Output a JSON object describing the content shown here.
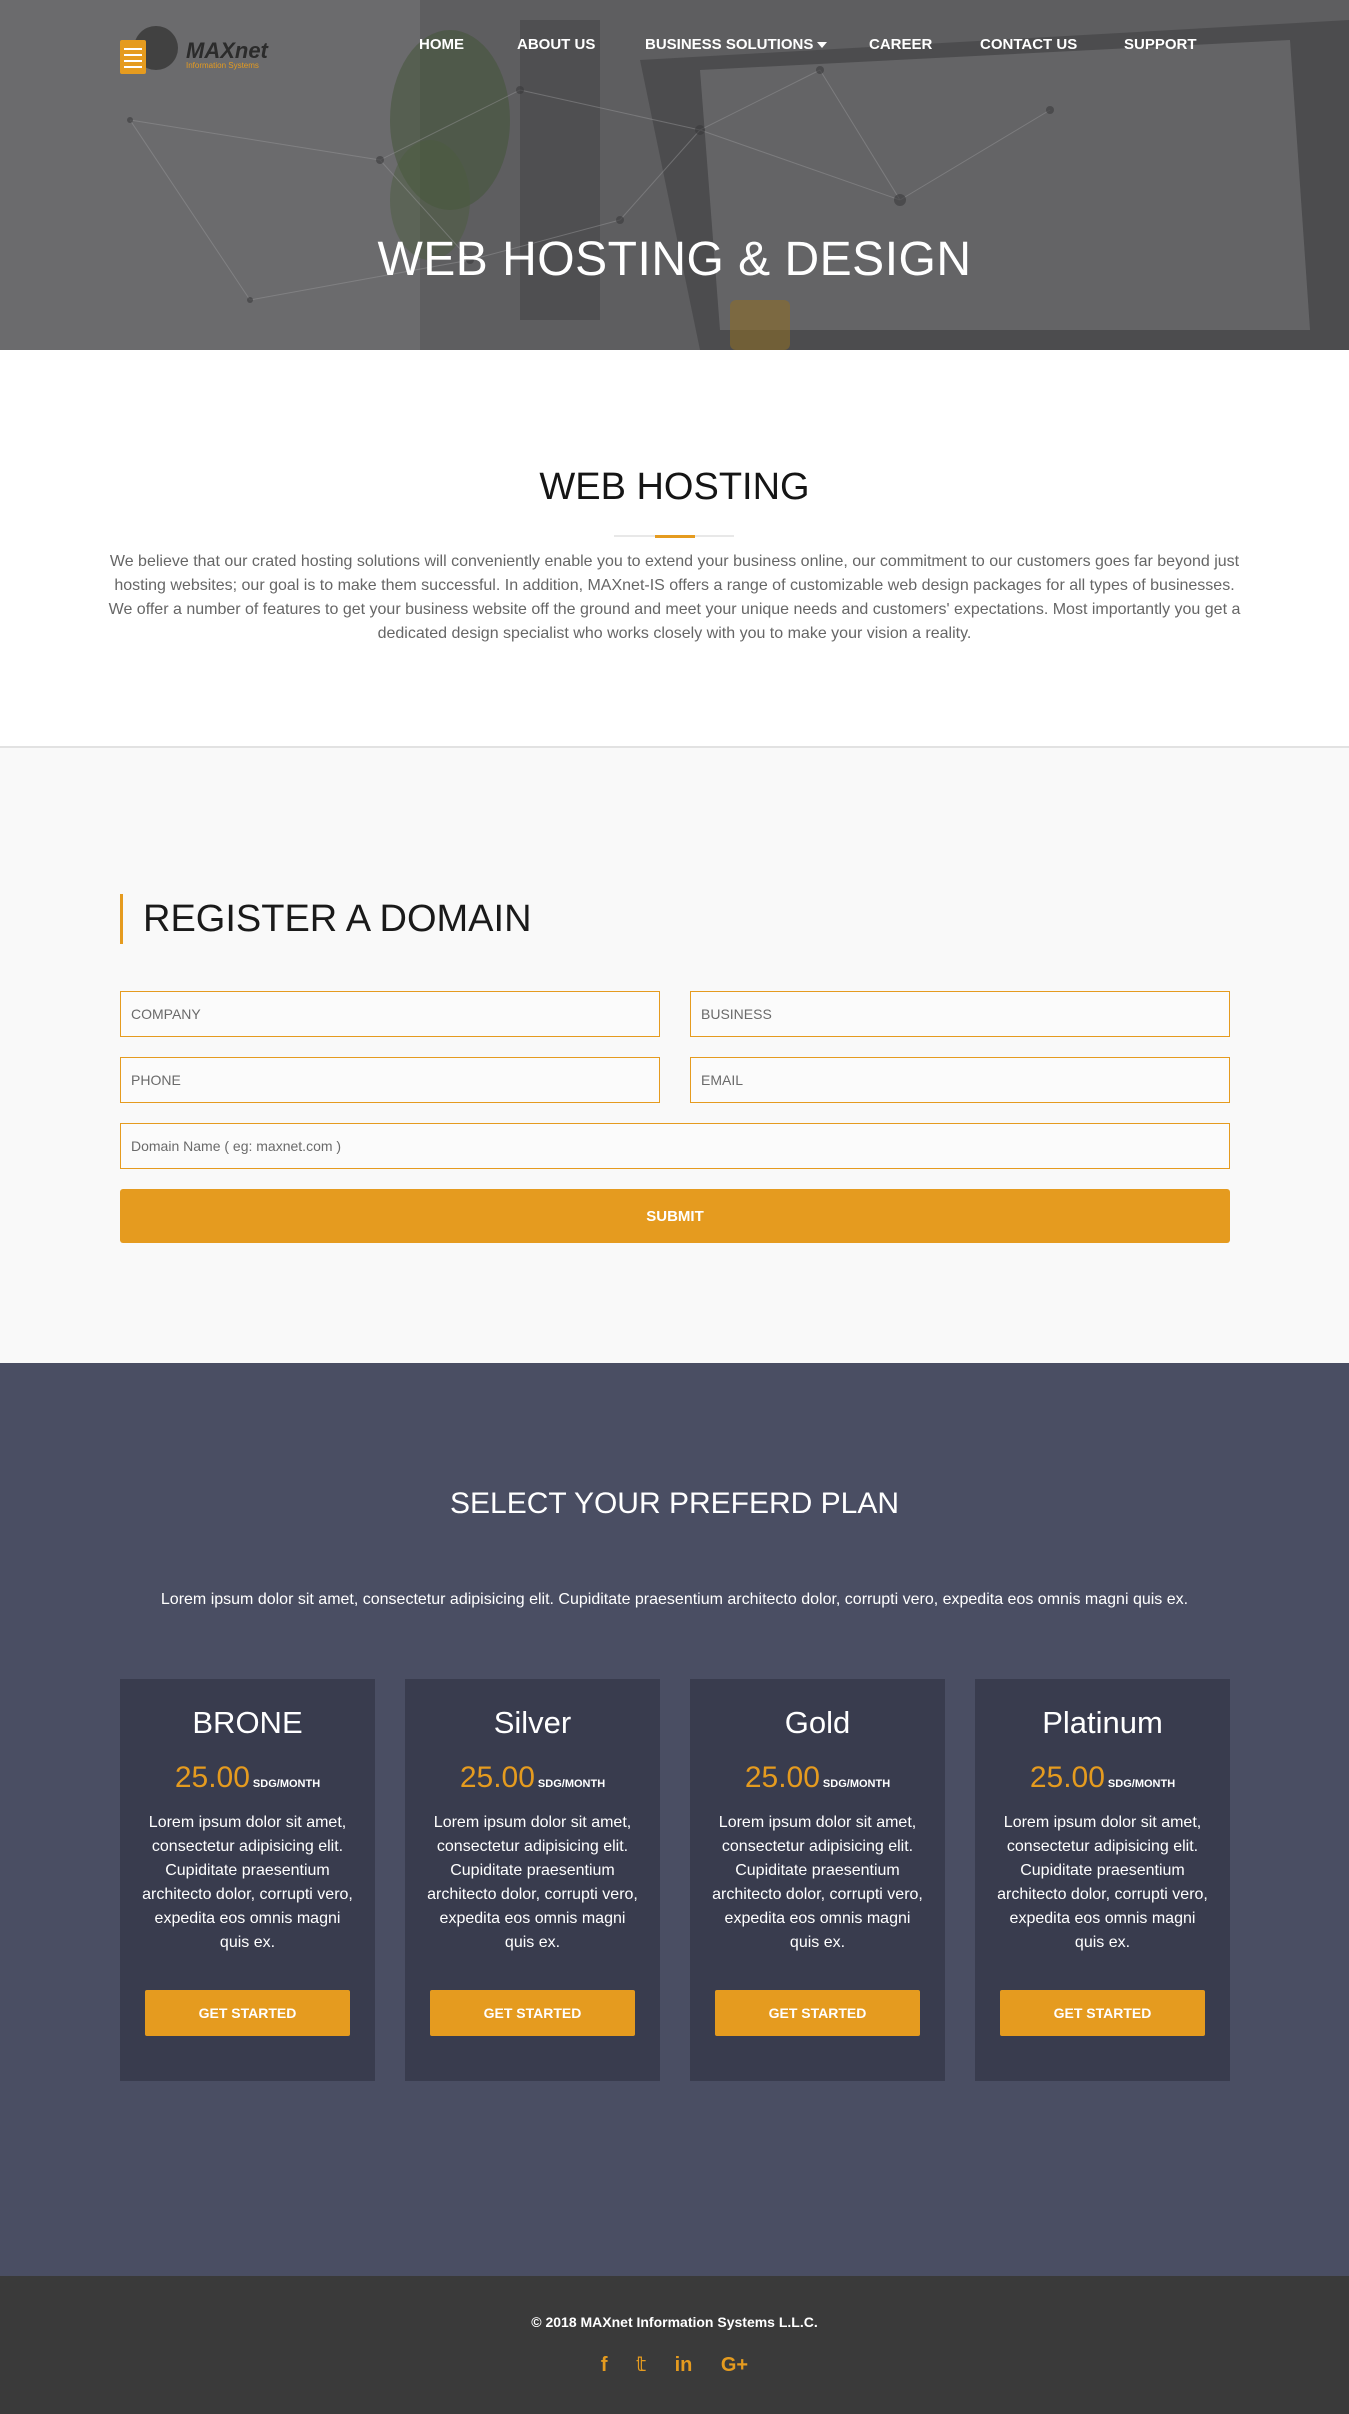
{
  "header": {
    "logo": {
      "name": "MAXnet",
      "subtitle": "Information Systems"
    },
    "nav": [
      {
        "label": "HOME"
      },
      {
        "label": "ABOUT US"
      },
      {
        "label": "BUSINESS SOLUTIONS",
        "has_dropdown": true
      },
      {
        "label": "CAREER"
      },
      {
        "label": "CONTACT US"
      },
      {
        "label": "SUPPORT"
      }
    ],
    "hero_title": "WEB HOSTING & DESIGN"
  },
  "about": {
    "title": "WEB HOSTING",
    "body": "We believe that our crated hosting solutions will conveniently enable you to extend your business online, our commitment to our customers goes far beyond just hosting websites; our goal is to make them successful. In addition, MAXnet-IS offers a range of customizable web design packages for all types of businesses. We offer a number of features to get your business website off the ground and meet your unique needs and customers' expectations. Most importantly you get a dedicated design specialist who works closely with you to make your vision a reality."
  },
  "register": {
    "title": "REGISTER A DOMAIN",
    "fields": {
      "company": {
        "placeholder": "COMPANY",
        "value": ""
      },
      "business": {
        "placeholder": "BUSINESS",
        "value": ""
      },
      "phone": {
        "placeholder": "PHONE",
        "value": ""
      },
      "email": {
        "placeholder": "EMAIL",
        "value": ""
      },
      "domain": {
        "placeholder": "Domain Name ( eg: maxnet.com )",
        "value": ""
      }
    },
    "submit_label": "SUBMIT"
  },
  "plans": {
    "title": "SELECT YOUR PREFERD PLAN",
    "intro": "Lorem ipsum dolor sit amet, consectetur adipisicing elit. Cupiditate praesentium architecto dolor, corrupti vero, expedita eos omnis magni quis ex.",
    "items": [
      {
        "name": "BRONE",
        "price": "25.00",
        "unit": "SDG/MONTH",
        "description": "Lorem ipsum dolor sit amet, consectetur adipisicing elit. Cupiditate praesentium architecto dolor, corrupti vero, expedita eos omnis magni quis ex.",
        "button": "GET STARTED"
      },
      {
        "name": "Silver",
        "price": "25.00",
        "unit": "SDG/MONTH",
        "description": "Lorem ipsum dolor sit amet, consectetur adipisicing elit. Cupiditate praesentium architecto dolor, corrupti vero, expedita eos omnis magni quis ex.",
        "button": "GET STARTED"
      },
      {
        "name": "Gold",
        "price": "25.00",
        "unit": "SDG/MONTH",
        "description": "Lorem ipsum dolor sit amet, consectetur adipisicing elit. Cupiditate praesentium architecto dolor, corrupti vero, expedita eos omnis magni quis ex.",
        "button": "GET STARTED"
      },
      {
        "name": "Platinum",
        "price": "25.00",
        "unit": "SDG/MONTH",
        "description": "Lorem ipsum dolor sit amet, consectetur adipisicing elit. Cupiditate praesentium architecto dolor, corrupti vero, expedita eos omnis magni quis ex.",
        "button": "GET STARTED"
      }
    ]
  },
  "footer": {
    "copyright": "© 2018 MAXnet Information Systems L.L.C.",
    "social": [
      {
        "icon": "facebook-icon",
        "glyph": "f"
      },
      {
        "icon": "twitter-icon",
        "glyph": "𝕥"
      },
      {
        "icon": "linkedin-icon",
        "glyph": "in"
      },
      {
        "icon": "google-plus-icon",
        "glyph": "G+"
      }
    ]
  },
  "colors": {
    "accent": "#e59b1f",
    "plans_bg": "#4a4e63",
    "card_bg": "#393c4e",
    "footer_bg": "#3a3a3a",
    "register_bg": "#f9f9f9"
  }
}
